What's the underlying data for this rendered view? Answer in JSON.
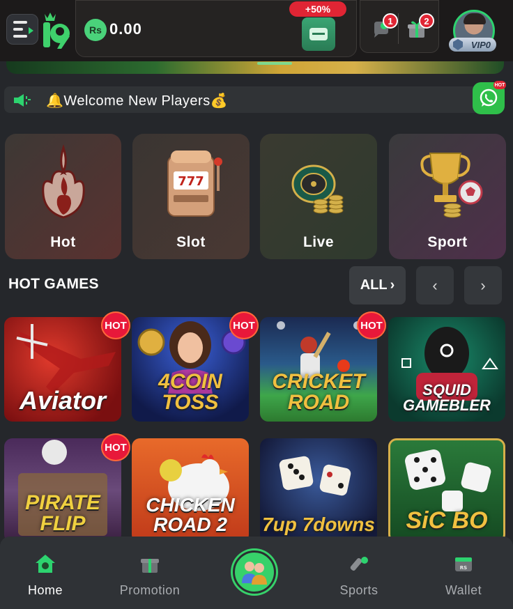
{
  "header": {
    "currency_symbol": "Rs",
    "balance": "0.00",
    "deposit_bonus": "+50%",
    "notification_count": "1",
    "gift_count": "2",
    "vip_level": "VIP0"
  },
  "marquee": {
    "text": "🔔Welcome New Players💰"
  },
  "whatsapp": {
    "badge": "HOT"
  },
  "categories": [
    {
      "label": "Hot",
      "icon": "flame-icon"
    },
    {
      "label": "Slot",
      "icon": "slot-machine-icon"
    },
    {
      "label": "Live",
      "icon": "roulette-icon"
    },
    {
      "label": "Sport",
      "icon": "trophy-icon"
    }
  ],
  "hot_games": {
    "title": "HOT GAMES",
    "all_label": "ALL",
    "prev_glyph": "‹",
    "next_glyph": "›",
    "hot_badge": "HOT",
    "games": [
      {
        "title": "Aviator",
        "hot": true
      },
      {
        "title": "4COIN TOSS",
        "hot": true
      },
      {
        "title": "CRICKET ROAD",
        "hot": true
      },
      {
        "title": "SQUID GAMEBLER",
        "hot": false
      },
      {
        "title": "PIRATE FLIP",
        "hot": true
      },
      {
        "title": "CHICKEN ROAD 2",
        "hot": false
      },
      {
        "title": "7up 7downs",
        "hot": false
      },
      {
        "title": "SiC BO",
        "hot": false
      }
    ]
  },
  "bottom_nav": {
    "items": [
      {
        "label": "Home",
        "active": true
      },
      {
        "label": "Promotion",
        "active": false
      },
      {
        "label": "Sports",
        "active": false
      },
      {
        "label": "Wallet",
        "active": false
      }
    ]
  },
  "colors": {
    "accent": "#2dd36f",
    "badge_red": "#e02534",
    "background": "#25272b"
  }
}
